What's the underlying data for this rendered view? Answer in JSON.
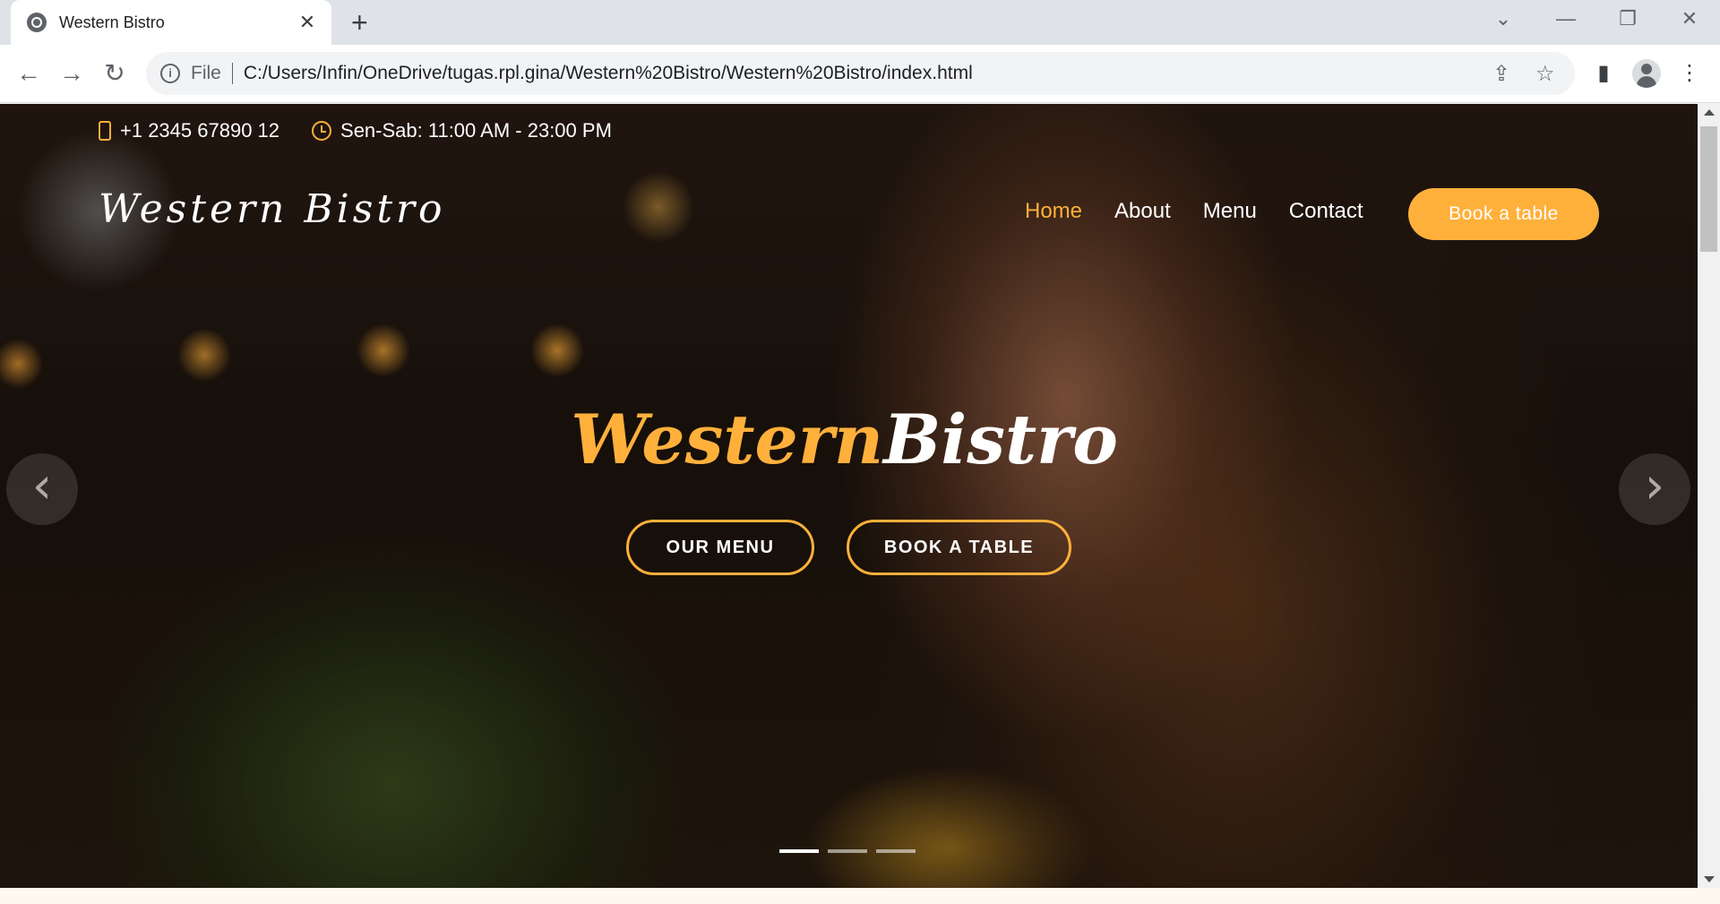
{
  "browser": {
    "tab_title": "Western Bistro",
    "tab_close": "✕",
    "new_tab": "+",
    "address_scheme": "File",
    "address_url": "C:/Users/Infin/OneDrive/tugas.rpl.gina/Western%20Bistro/Western%20Bistro/index.html",
    "icons": {
      "back": "←",
      "forward": "→",
      "reload": "↻",
      "share": "⇪",
      "star": "☆",
      "sidepanel": "▮",
      "menu": "⋮",
      "minimize": "—",
      "restore": "❐",
      "close": "✕",
      "tabsearch": "⌄"
    }
  },
  "topbar": {
    "phone": "+1 2345 67890 12",
    "hours": "Sen-Sab: 11:00 AM - 23:00 PM"
  },
  "header": {
    "logo": "Western Bistro",
    "nav": [
      "Home",
      "About",
      "Menu",
      "Contact"
    ],
    "active_nav": "Home",
    "cta": "Book a table"
  },
  "hero": {
    "brand_part1": "Western",
    "brand_part2": "Bistro",
    "button_menu": "OUR MENU",
    "button_book": "BOOK A TABLE",
    "prev_arrow": "‹",
    "next_arrow": "›",
    "slide_count": 3,
    "active_slide": 1
  },
  "colors": {
    "accent": "#ffb03b",
    "text_light": "#ffffff"
  }
}
